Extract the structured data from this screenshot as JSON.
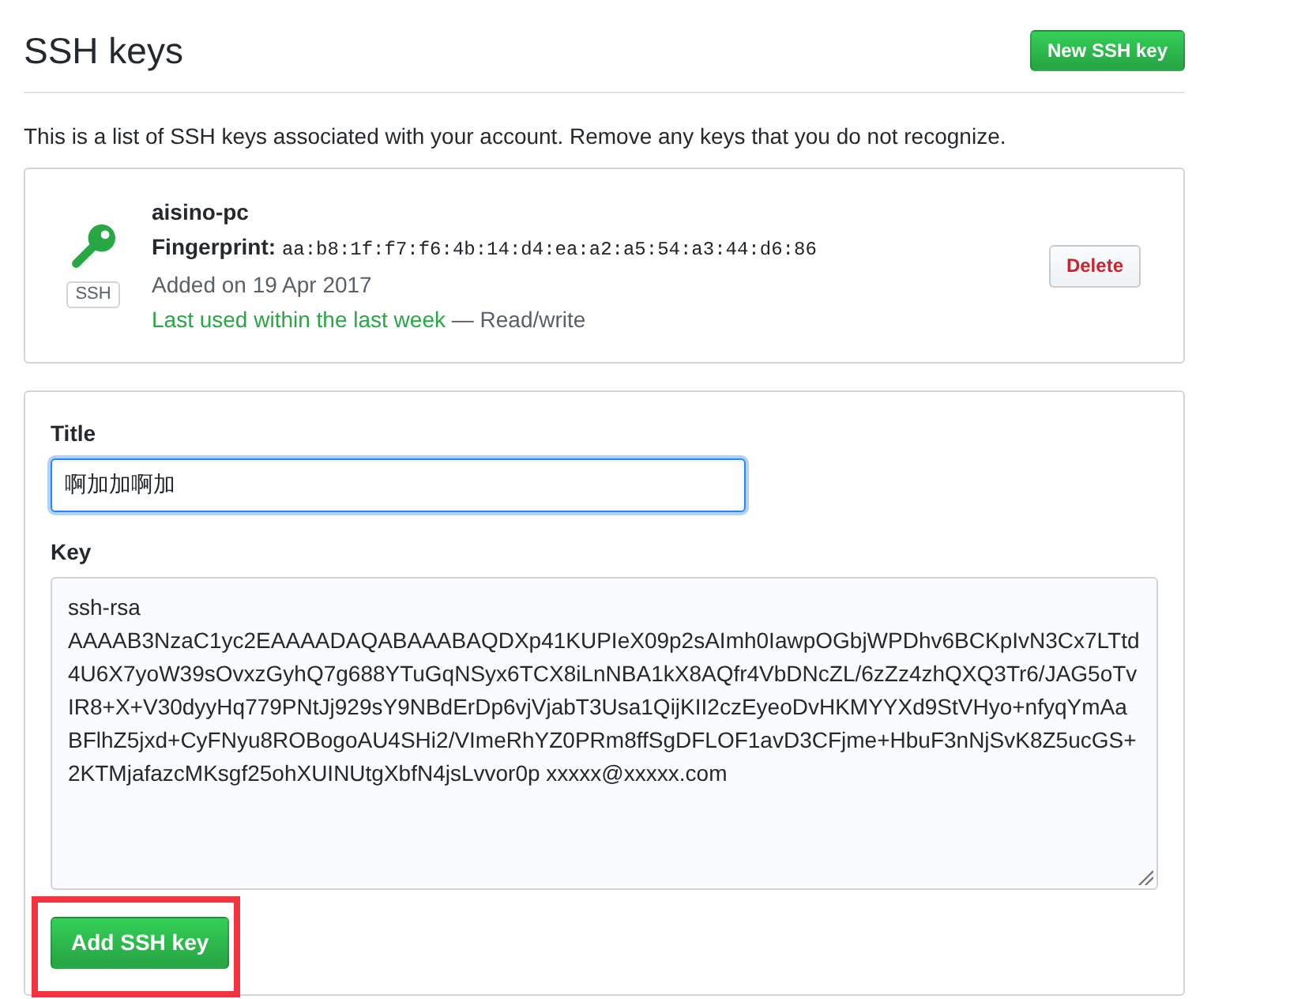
{
  "header": {
    "title": "SSH keys",
    "new_button": "New SSH key"
  },
  "description": "This is a list of SSH keys associated with your account. Remove any keys that you do not recognize.",
  "keys": [
    {
      "type_badge": "SSH",
      "name": "aisino-pc",
      "fingerprint_label": "Fingerprint:",
      "fingerprint": "aa:b8:1f:f7:f6:4b:14:d4:ea:a2:a5:54:a3:44:d6:86",
      "added": "Added on 19 Apr 2017",
      "last_used": "Last used within the last week",
      "access": "— Read/write",
      "delete_button": "Delete"
    }
  ],
  "add_form": {
    "title_label": "Title",
    "title_value": "啊加加啊加",
    "title_focused": true,
    "key_label": "Key",
    "key_value": "ssh-rsa AAAAB3NzaC1yc2EAAAADAQABAAABAQDXp41KUPIeX09p2sAImh0IawpOGbjWPDhv6BCKpIvN3Cx7LTtd4U6X7yoW39sOvxzGyhQ7g688YTuGqNSyx6TCX8iLnNBA1kX8AQfr4VbDNcZL/6zZz4zhQXQ3Tr6/JAG5oTvIR8+X+V30dyyHq779PNtJj929sY9NBdErDp6vjVjabT3Usa1QijKII2czEyeoDvHKMYYXd9StVHyo+nfyqYmAaBFlhZ5jxd+CyFNyu8ROBogoAU4SHi2/VImeRhYZ0PRm8ffSgDFLOF1avD3CFjme+HbuF3nNjSvK8Z5ucGS+2KTMjafazcMKsgf25ohXUINUtgXbfN4jsLvvor0p xxxxx@xxxxx.com",
    "submit": {
      "label": "Add SSH key",
      "highlighted": true
    }
  }
}
